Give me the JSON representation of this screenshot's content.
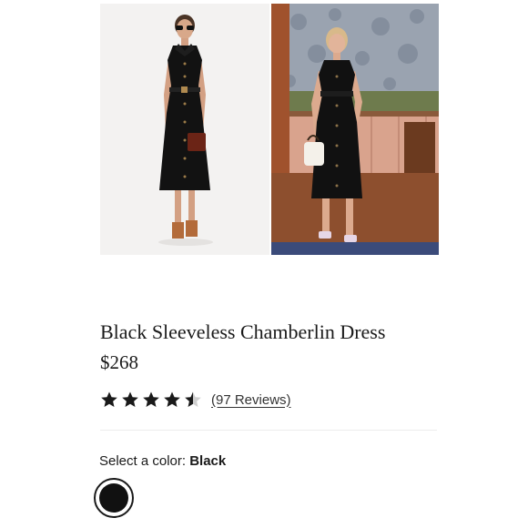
{
  "product": {
    "title": "Black Sleeveless Chamberlin Dress",
    "price": "$268"
  },
  "rating": {
    "value": 4.5,
    "max": 5,
    "reviews_text": "(97 Reviews)"
  },
  "color_selector": {
    "label": "Select a color:",
    "selected": "Black",
    "swatches": [
      {
        "name": "Black",
        "hex": "#111111"
      }
    ]
  },
  "gallery": {
    "images": [
      "studio-product-photo",
      "lifestyle-product-photo"
    ]
  },
  "colors": {
    "text": "#1a1a1a",
    "star": "#1a1a1a",
    "star_empty": "#cfcfcf"
  }
}
